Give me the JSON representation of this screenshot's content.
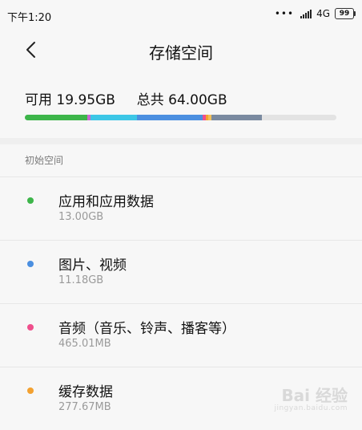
{
  "status_bar": {
    "time": "下午1:20",
    "dots": "•••",
    "network": "4G",
    "battery": "99"
  },
  "header": {
    "title": "存储空间",
    "back_icon": "chevron-left-icon"
  },
  "summary": {
    "available_label": "可用",
    "available_value": "19.95GB",
    "total_label": "总共",
    "total_value": "64.00GB",
    "usage_segments": [
      {
        "name": "apps",
        "color": "#3db54a",
        "fraction": 0.2
      },
      {
        "name": "misc1",
        "color": "#c86ad1",
        "fraction": 0.01
      },
      {
        "name": "images",
        "color": "#3cc6e6",
        "fraction": 0.15
      },
      {
        "name": "videos",
        "color": "#4b8fe0",
        "fraction": 0.21
      },
      {
        "name": "audio",
        "color": "#ef4f8c",
        "fraction": 0.01
      },
      {
        "name": "cache",
        "color": "#f3a130",
        "fraction": 0.01
      },
      {
        "name": "misc2",
        "color": "#f2c05a",
        "fraction": 0.01
      },
      {
        "name": "other",
        "color": "#7a8aa0",
        "fraction": 0.16
      }
    ],
    "bar_track_color": "#e3e3e3"
  },
  "section": {
    "title": "初始空间"
  },
  "items": [
    {
      "name": "应用和应用数据",
      "size": "13.00GB",
      "color": "#3db54a"
    },
    {
      "name": "图片、视频",
      "size": "11.18GB",
      "color": "#4b8fe0"
    },
    {
      "name": "音频（音乐、铃声、播客等）",
      "size": "465.01MB",
      "color": "#ef4f8c"
    },
    {
      "name": "缓存数据",
      "size": "277.67MB",
      "color": "#f3a130"
    }
  ],
  "watermark": {
    "main": "Bai 经验",
    "sub": "jingyan.baidu.com"
  }
}
